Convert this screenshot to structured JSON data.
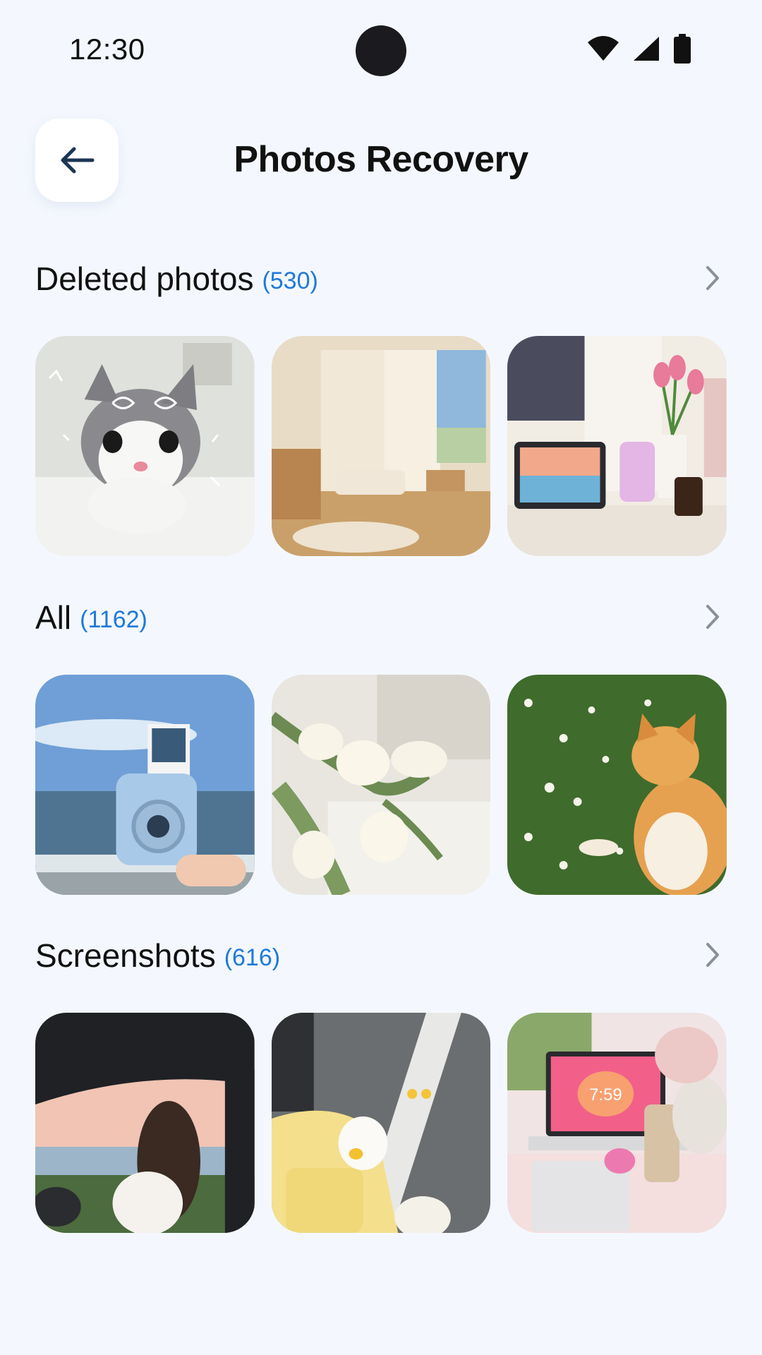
{
  "status": {
    "time": "12:30",
    "icons": [
      "wifi-icon",
      "cellular-signal-icon",
      "battery-icon"
    ]
  },
  "header": {
    "title": "Photos Recovery",
    "back_icon": "arrow-left-icon"
  },
  "colors": {
    "background": "#f4f8fe",
    "accent": "#1e7ad9",
    "text": "#111111",
    "chevron": "#8a8f98"
  },
  "sections": [
    {
      "title": "Deleted photos",
      "count": "(530)",
      "thumbnails": [
        "cat-with-doodles-photo",
        "cozy-room-photo",
        "desk-tablet-tulips-photo"
      ]
    },
    {
      "title": "All",
      "count": "(1162)",
      "thumbnails": [
        "instant-camera-beach-photo",
        "white-tulips-photo",
        "cat-in-flowers-photo"
      ]
    },
    {
      "title": "Screenshots",
      "count": "(616)",
      "thumbnails": [
        "girl-in-car-window-photo",
        "yellow-bag-toy-photo",
        "laptop-bed-photo"
      ]
    }
  ],
  "laptop_clock": "7:59"
}
